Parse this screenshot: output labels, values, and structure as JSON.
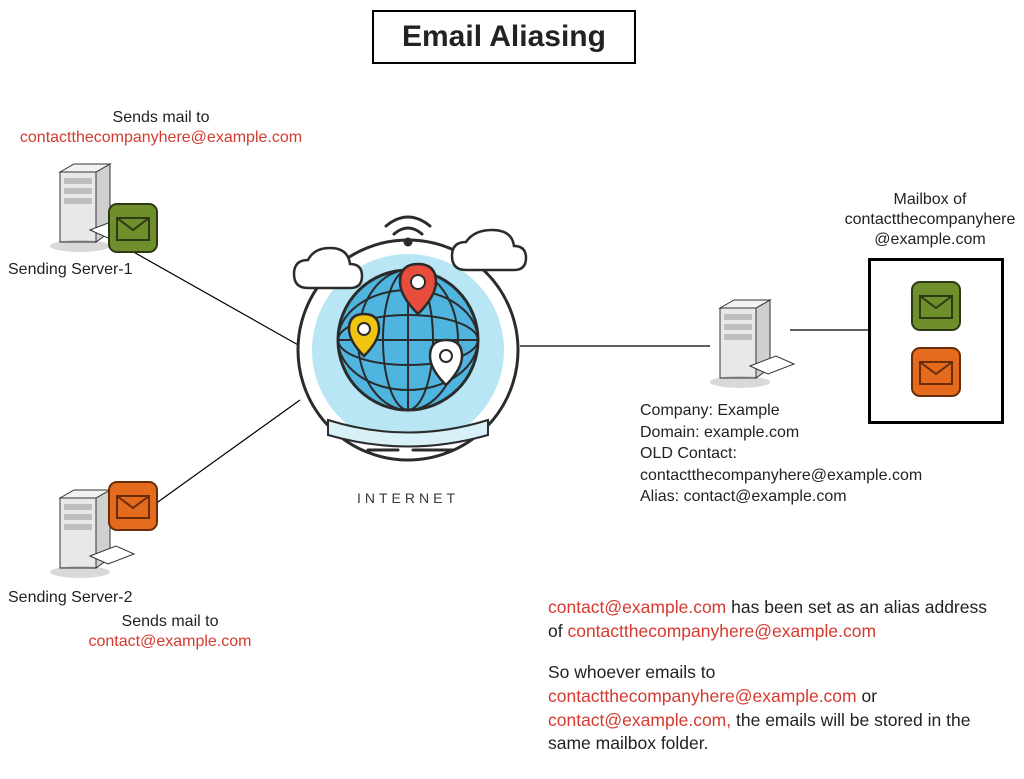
{
  "title": "Email Aliasing",
  "internet_label": "INTERNET",
  "sender1": {
    "label": "Sending Server-1",
    "sends_prefix": "Sends mail to",
    "sends_email": "contactthecompanyhere@example.com"
  },
  "sender2": {
    "label": "Sending Server-2",
    "sends_prefix": "Sends mail to",
    "sends_email": "contact@example.com"
  },
  "company_info": {
    "company_label": "Company: ",
    "company_value": "Example",
    "domain_label": "Domain: ",
    "domain_value": "example.com",
    "old_contact_label": "OLD Contact:",
    "old_contact_value": "contactthecompanyhere@example.com",
    "alias_label": "Alias: ",
    "alias_value": "contact@example.com"
  },
  "mailbox": {
    "header_prefix": "Mailbox of",
    "header_email": "contactthecompanyhere@example.com"
  },
  "explain": {
    "alias_email": "contact@example.com",
    "line1_mid": " has been set as an alias address of ",
    "main_email": "contactthecompanyhere@example.com",
    "line2_prefix": "So whoever emails to ",
    "line2_or": " or ",
    "line2_suffix": " the emails will be stored in the same mailbox folder.",
    "comma": ","
  },
  "colors": {
    "env_green": "#6f8f2d",
    "env_orange": "#e46a1e",
    "red": "#d43a2f",
    "globe_blue": "#4fb4de",
    "globe_ring": "#b9e6f4",
    "pin_red": "#e84c3d",
    "pin_yellow": "#f1c40f"
  }
}
